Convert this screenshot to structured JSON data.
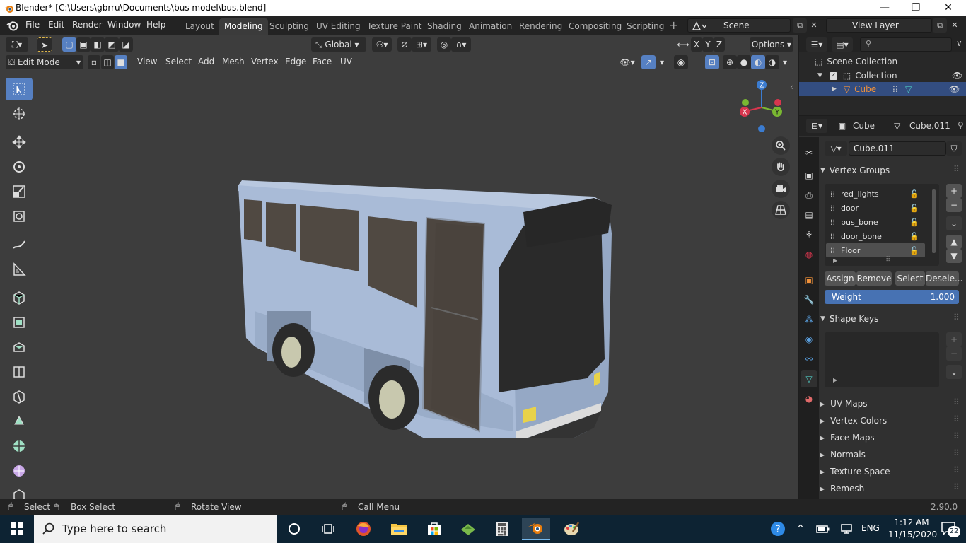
{
  "window": {
    "title": "Blender* [C:\\Users\\gbrru\\Documents\\bus model\\bus.blend]",
    "minimize": "—",
    "maximize": "❐",
    "close": "✕"
  },
  "menubar": {
    "items": [
      "File",
      "Edit",
      "Render",
      "Window",
      "Help"
    ]
  },
  "workspaces": {
    "tabs": [
      "Layout",
      "Modeling",
      "Sculpting",
      "UV Editing",
      "Texture Paint",
      "Shading",
      "Animation",
      "Rendering",
      "Compositing",
      "Scripting"
    ],
    "active": "Modeling",
    "add": "+"
  },
  "scene": {
    "label": "Scene",
    "view_layer": "View Layer"
  },
  "viewport_header": {
    "transform_orientation": "Global",
    "options": "Options",
    "axes": [
      "X",
      "Y",
      "Z"
    ],
    "mode": "Edit Mode",
    "menus": [
      "View",
      "Select",
      "Add",
      "Mesh",
      "Vertex",
      "Edge",
      "Face",
      "UV"
    ]
  },
  "gizmo": {
    "x": "X",
    "y": "Y",
    "z": "Z"
  },
  "outliner": {
    "scene_collection": "Scene Collection",
    "collection": "Collection",
    "object": "Cube",
    "search_placeholder": ""
  },
  "properties": {
    "object": "Cube",
    "mesh": "Cube.011",
    "mesh_field": "Cube.011",
    "vertex_groups_title": "Vertex Groups",
    "vertex_groups": [
      "red_lights",
      "door",
      "bus_bone",
      "door_bone",
      "Floor"
    ],
    "selected_group": "Floor",
    "buttons": {
      "assign": "Assign",
      "remove": "Remove",
      "select": "Select",
      "deselect": "Desele..."
    },
    "weight_label": "Weight",
    "weight_value": "1.000",
    "shape_keys_title": "Shape Keys",
    "collapsed_panels": [
      "UV Maps",
      "Vertex Colors",
      "Face Maps",
      "Normals",
      "Texture Space",
      "Remesh"
    ]
  },
  "statusbar": {
    "select": "Select",
    "box_select": "Box Select",
    "rotate_view": "Rotate View",
    "call_menu": "Call Menu",
    "version": "2.90.0"
  },
  "taskbar": {
    "search_placeholder": "Type here to search",
    "language": "ENG",
    "time": "1:12 AM",
    "date": "11/15/2020",
    "notifications": "22"
  },
  "colors": {
    "accent": "#5680c2",
    "selected_object": "#f0913a",
    "bus_body": "#a9bbd7",
    "bus_window": "#504942",
    "taskbar": "#0d2333"
  }
}
